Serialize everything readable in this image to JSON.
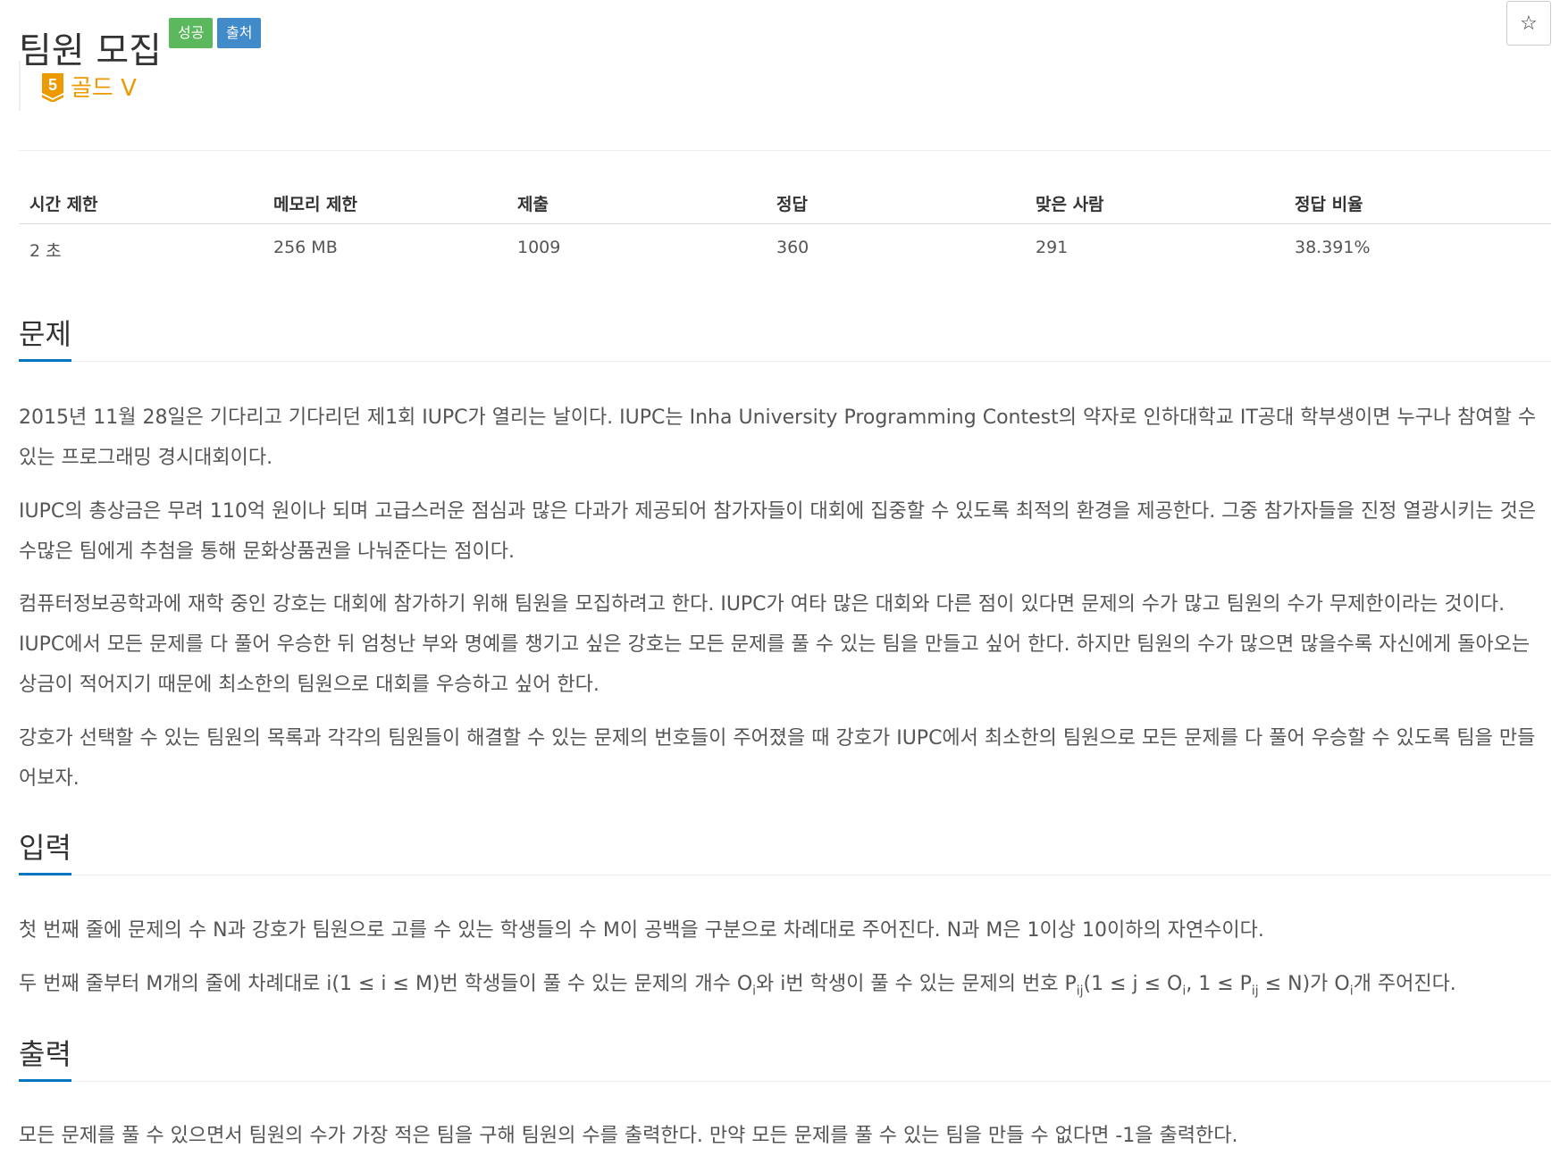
{
  "header": {
    "title": "팀원 모집",
    "badge_success": "성공",
    "badge_source": "출처",
    "star_icon": "☆",
    "tier": {
      "level": "5",
      "label": "골드 V",
      "color": "#ec9a00"
    }
  },
  "stats": {
    "headers": [
      "시간 제한",
      "메모리 제한",
      "제출",
      "정답",
      "맞은 사람",
      "정답 비율"
    ],
    "values": [
      "2 초",
      "256 MB",
      "1009",
      "360",
      "291",
      "38.391%"
    ]
  },
  "sections": {
    "problem": {
      "title": "문제",
      "paragraphs": [
        "2015년 11월 28일은 기다리고 기다리던 제1회 IUPC가 열리는 날이다. IUPC는 Inha University Programming Contest의 약자로 인하대학교 IT공대 학부생이면 누구나 참여할 수 있는 프로그래밍 경시대회이다.",
        "IUPC의 총상금은 무려 110억 원이나 되며 고급스러운 점심과 많은 다과가 제공되어 참가자들이 대회에 집중할 수 있도록 최적의 환경을 제공한다. 그중 참가자들을 진정 열광시키는 것은 수많은 팀에게 추첨을 통해 문화상품권을 나눠준다는 점이다.",
        "컴퓨터정보공학과에 재학 중인 강호는 대회에 참가하기 위해 팀원을 모집하려고 한다. IUPC가 여타 많은 대회와 다른 점이 있다면 문제의 수가 많고 팀원의 수가 무제한이라는 것이다. IUPC에서 모든 문제를 다 풀어 우승한 뒤 엄청난 부와 명예를 챙기고 싶은 강호는 모든 문제를 풀 수 있는 팀을 만들고 싶어 한다. 하지만 팀원의 수가 많으면 많을수록 자신에게 돌아오는 상금이 적어지기 때문에 최소한의 팀원으로 대회를 우승하고 싶어 한다.",
        "강호가 선택할 수 있는 팀원의 목록과 각각의 팀원들이 해결할 수 있는 문제의 번호들이 주어졌을 때 강호가 IUPC에서 최소한의 팀원으로 모든 문제를 다 풀어 우승할 수 있도록 팀을 만들어보자."
      ]
    },
    "input": {
      "title": "입력",
      "line1": "첫 번째 줄에 문제의 수 N과 강호가 팀원으로 고를 수 있는 학생들의 수 M이 공백을 구분으로 차례대로 주어진다. N과 M은 1이상 10이하의 자연수이다.",
      "line2": {
        "a": "두 번째 줄부터 M개의 줄에 차례대로 i(1 ≤ i ≤ M)번 학생들이 풀 수 있는 문제의 개수 O",
        "s1": "i",
        "b": "와 i번 학생이 풀 수 있는 문제의 번호 P",
        "s2": "ij",
        "c": "(1 ≤ j ≤ O",
        "s3": "i",
        "d": ", 1 ≤ P",
        "s4": "ij",
        "e": " ≤ N)가 O",
        "s5": "i",
        "f": "개 주어진다."
      }
    },
    "output": {
      "title": "출력",
      "line1": "모든 문제를 풀 수 있으면서 팀원의 수가 가장 적은 팀을 구해 팀원의 수를 출력한다. 만약 모든 문제를 풀 수 있는 팀을 만들 수 없다면 -1을 출력한다."
    }
  }
}
